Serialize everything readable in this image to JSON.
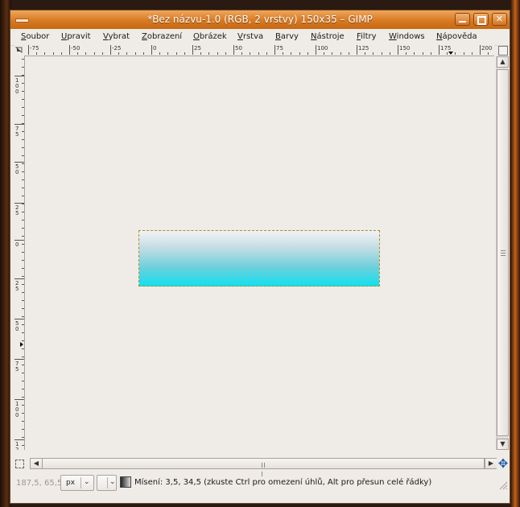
{
  "window": {
    "title": "*Bez názvu-1.0 (RGB, 2 vrstvy) 150x35 – GIMP"
  },
  "menubar": {
    "items": [
      {
        "label": "Soubor",
        "mnemonic": "S"
      },
      {
        "label": "Upravit",
        "mnemonic": "U"
      },
      {
        "label": "Vybrat",
        "mnemonic": "V"
      },
      {
        "label": "Zobrazení",
        "mnemonic": "Z"
      },
      {
        "label": "Obrázek",
        "mnemonic": "O"
      },
      {
        "label": "Vrstva",
        "mnemonic": "V"
      },
      {
        "label": "Barvy",
        "mnemonic": "B"
      },
      {
        "label": "Nástroje",
        "mnemonic": "N"
      },
      {
        "label": "Filtry",
        "mnemonic": "F"
      },
      {
        "label": "Windows",
        "mnemonic": "W"
      },
      {
        "label": "Nápověda",
        "mnemonic": "N"
      }
    ]
  },
  "rulers": {
    "horizontal_labels": [
      "-75",
      "-50",
      "-25",
      "0",
      "25",
      "50",
      "75",
      "100",
      "125",
      "150",
      "175",
      "200"
    ],
    "vertical_labels": [
      "100",
      "75",
      "50",
      "25",
      "0",
      "25",
      "50",
      "75",
      "100",
      "125"
    ]
  },
  "layer": {
    "gradient_top": "#f2f3f5",
    "gradient_bottom": "#0fe0f0"
  },
  "statusbar": {
    "coords": "187,5, 65,5",
    "unit": "px",
    "message": "Mísení: 3,5, 34,5 (zkuste Ctrl pro omezení úhlů, Alt pro přesun celé řádky)"
  },
  "icons": {
    "window_menu": "window-menu-icon",
    "minimize": "minimize-icon",
    "maximize": "maximize-icon",
    "close": "close-icon",
    "navigate": "navigate-icon",
    "quick_mask": "quick-mask-icon",
    "zoom_nav": "zoom-navigation-icon",
    "blend_tool": "blend-tool-icon"
  }
}
